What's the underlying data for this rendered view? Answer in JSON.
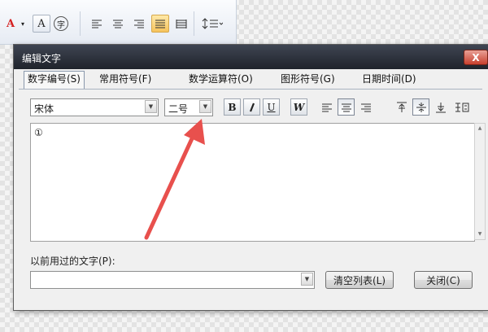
{
  "ribbon": {
    "font_color_label": "A",
    "char_shading_label": "A",
    "enclose_char_label": "字"
  },
  "dialog": {
    "title": "编辑文字",
    "close_label": "X",
    "tabs": [
      {
        "label": "数字编号(S)",
        "active": true
      },
      {
        "label": "常用符号(F)",
        "active": false
      },
      {
        "label": "数学运算符(O)",
        "active": false
      },
      {
        "label": "图形符号(G)",
        "active": false
      },
      {
        "label": "日期时间(D)",
        "active": false
      }
    ],
    "font_select": {
      "value": "宋体"
    },
    "size_select": {
      "value": "二号"
    },
    "format": {
      "bold": "B",
      "italic": "I",
      "underline": "U",
      "wordart": "W"
    },
    "editor_text": "①",
    "previous_label": "以前用过的文字(P):",
    "previous_select": {
      "value": ""
    },
    "clear_button": "清空列表(L)",
    "close_button": "关闭(C)"
  },
  "colors": {
    "arrow": "#e8504d",
    "titlebar": "#2b2f38",
    "font_color_a": "#d42020"
  }
}
